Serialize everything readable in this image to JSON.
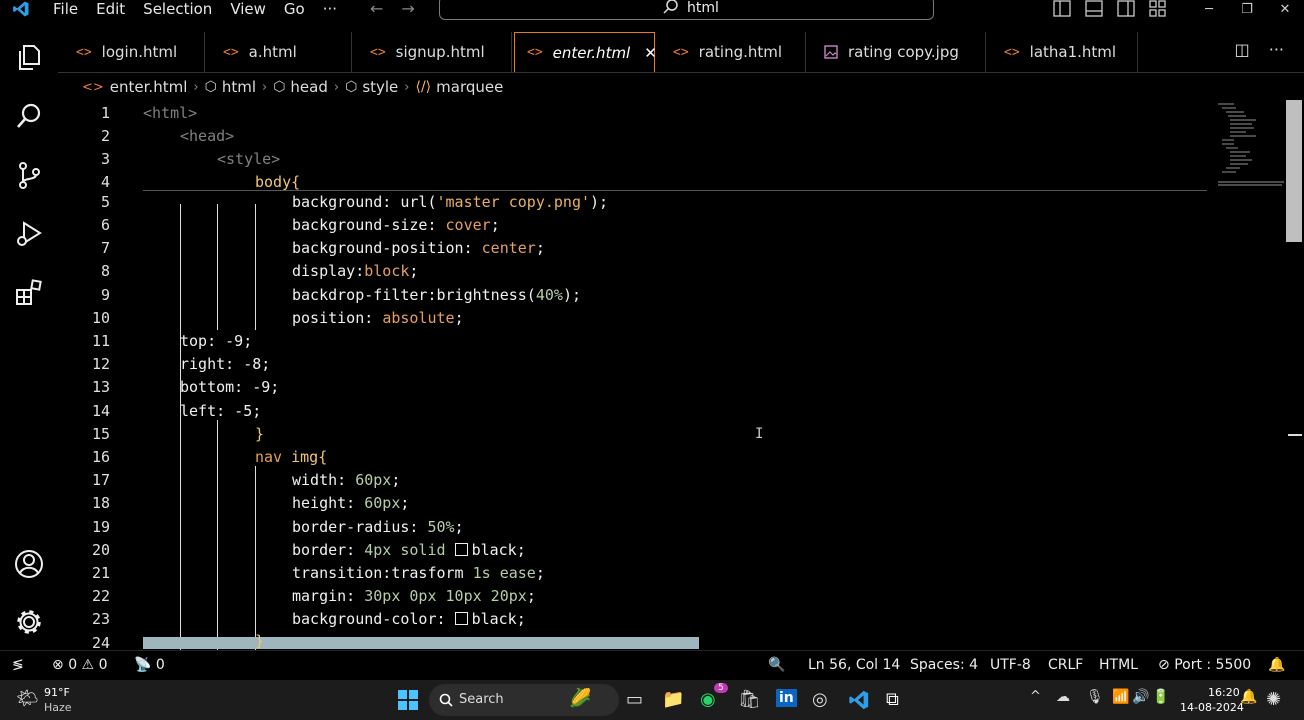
{
  "menu": [
    "File",
    "Edit",
    "Selection",
    "View",
    "Go",
    "···"
  ],
  "command_center": {
    "text": "html"
  },
  "tabs": [
    {
      "label": "login.html",
      "icon": "<>"
    },
    {
      "label": "a.html",
      "icon": "<>"
    },
    {
      "label": "signup.html",
      "icon": "<>"
    },
    {
      "label": "enter.html",
      "icon": "<>",
      "active": true
    },
    {
      "label": "rating.html",
      "icon": "<>"
    },
    {
      "label": "rating copy.jpg",
      "icon": "image-icon"
    },
    {
      "label": "latha1.html",
      "icon": "<>"
    }
  ],
  "breadcrumb": [
    "enter.html",
    "html",
    "head",
    "style",
    "marquee"
  ],
  "line_numbers": [
    "1",
    "2",
    "3",
    "4",
    "5",
    "6",
    "7",
    "8",
    "9",
    "10",
    "11",
    "12",
    "13",
    "14",
    "15",
    "16",
    "17",
    "18",
    "19",
    "20",
    "21",
    "22",
    "23",
    "24"
  ],
  "code": {
    "l1": "<html>",
    "l2": "<head>",
    "l3": "<style>",
    "l4": "body{",
    "l5a": "background: url(",
    "l5b": "'master copy.png'",
    "l5c": ");",
    "l6a": "background-size: ",
    "l6b": "cover",
    "l6c": ";",
    "l7a": "background-position: ",
    "l7b": "center",
    "l7c": ";",
    "l8a": "display:",
    "l8b": "block",
    "l8c": ";",
    "l9a": "backdrop-filter:brightness(",
    "l9b": "40%",
    "l9c": ");",
    "l10a": "position: ",
    "l10b": "absolute",
    "l10c": ";",
    "l11": "top: -9;",
    "l12": "right: -8;",
    "l13": "bottom: -9;",
    "l14": "left: -5;",
    "l15": "}",
    "l16a": "nav ",
    "l16b": "img{",
    "l17a": "width: ",
    "l17b": "60px",
    "l17c": ";",
    "l18a": "height: ",
    "l18b": "60px",
    "l18c": ";",
    "l19a": "border-radius: ",
    "l19b": "50%",
    "l19c": ";",
    "l20a": "border: ",
    "l20b": "4px solid ",
    "l20c": "black",
    "l20d": ";",
    "l21a": "transition:trasform ",
    "l21b": "1s ease",
    "l21c": ";",
    "l22a": "margin: ",
    "l22b": "30px 0px 10px 20px",
    "l22c": ";",
    "l23a": "background-color: ",
    "l23b": "black",
    "l23c": ";",
    "l24": "}"
  },
  "status": {
    "errors": "0",
    "warnings": "0",
    "ports": "0",
    "position": "Ln 56, Col 14",
    "spaces": "Spaces: 4",
    "encoding": "UTF-8",
    "eol": "CRLF",
    "language": "HTML",
    "port": "Port : 5500"
  },
  "taskbar": {
    "weather_temp": "91°F",
    "weather_desc": "Haze",
    "search": "Search",
    "time": "16:20",
    "date": "14-08-2024",
    "teams_badge": "5"
  },
  "colors": {
    "accent": "#e87b1c",
    "tag": "#808080",
    "string": "#e8b067",
    "number": "#b5cea8"
  }
}
